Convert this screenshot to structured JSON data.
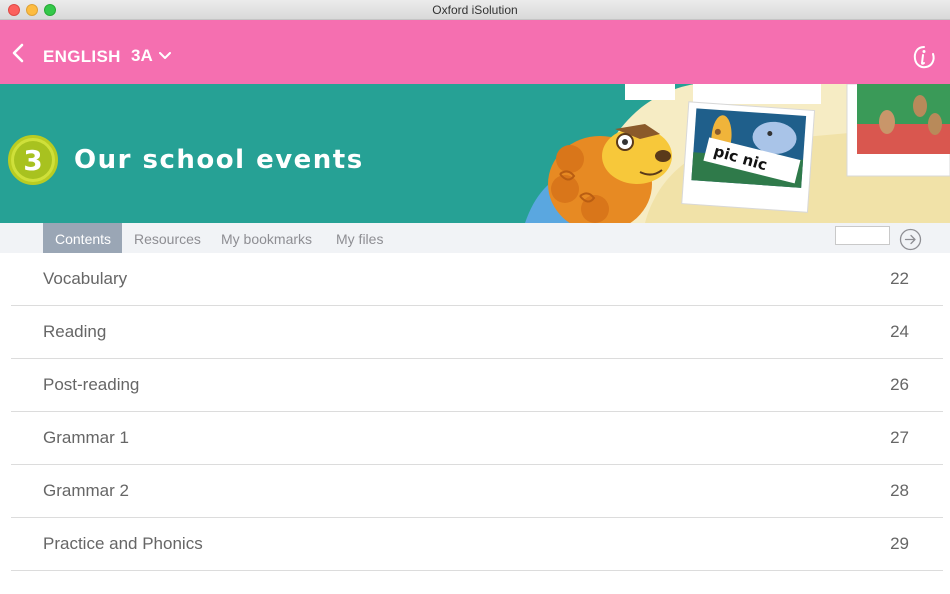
{
  "window": {
    "title": "Oxford iSolution"
  },
  "header": {
    "subject": "ENGLISH",
    "level": "3A",
    "back_icon": "chevron-left-icon",
    "dropdown_icon": "chevron-down-icon",
    "logo_icon": "oxford-i-logo-icon",
    "background": "#f56fb0"
  },
  "banner": {
    "unit_number": "3",
    "unit_title": "Our school events",
    "sign_text": "pic nic",
    "background": "#26a195"
  },
  "tabs": [
    {
      "label": "Contents",
      "active": true
    },
    {
      "label": "Resources",
      "active": false
    },
    {
      "label": "My bookmarks",
      "active": false
    },
    {
      "label": "My files",
      "active": false
    }
  ],
  "search": {
    "placeholder": "",
    "go_icon": "arrow-right-circle-icon"
  },
  "contents": [
    {
      "title": "Vocabulary",
      "page": "22"
    },
    {
      "title": "Reading",
      "page": "24"
    },
    {
      "title": "Post-reading",
      "page": "26"
    },
    {
      "title": "Grammar 1",
      "page": "27"
    },
    {
      "title": "Grammar 2",
      "page": "28"
    },
    {
      "title": "Practice and Phonics",
      "page": "29"
    }
  ]
}
